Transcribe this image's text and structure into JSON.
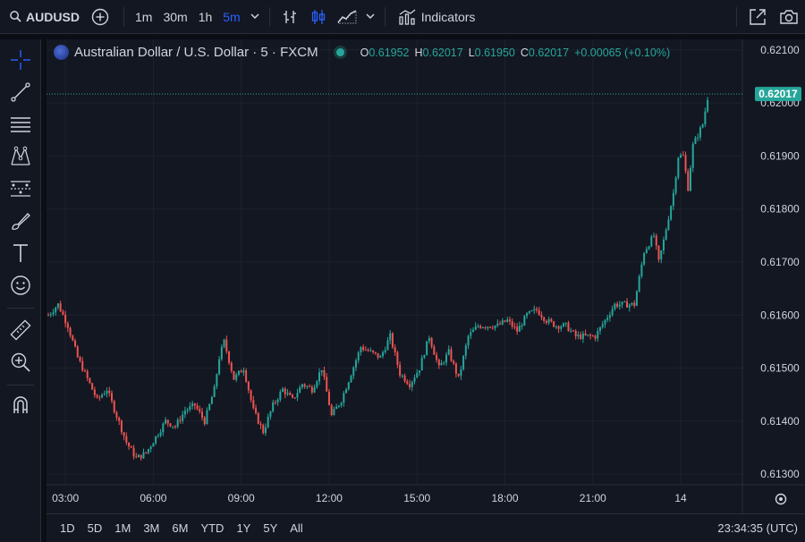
{
  "toolbar": {
    "symbol": "AUDUSD",
    "intervals": [
      "1m",
      "30m",
      "1h",
      "5m"
    ],
    "active_interval": "5m",
    "indicators_label": "Indicators"
  },
  "legend": {
    "title": "Australian Dollar / U.S. Dollar · 5 · FXCM",
    "o_label": "O",
    "o": "0.61952",
    "h_label": "H",
    "h": "0.62017",
    "l_label": "L",
    "l": "0.61950",
    "c_label": "C",
    "c": "0.62017",
    "change": "+0.00065 (+0.10%)"
  },
  "price_axis": {
    "ticks": [
      "0.62100",
      "0.62000",
      "0.61900",
      "0.61800",
      "0.61700",
      "0.61600",
      "0.61500",
      "0.61400",
      "0.61300"
    ],
    "current_price": "0.62017"
  },
  "time_axis": {
    "ticks": [
      "03:00",
      "06:00",
      "09:00",
      "12:00",
      "15:00",
      "18:00",
      "21:00",
      "14"
    ]
  },
  "ranges": [
    "1D",
    "5D",
    "1M",
    "3M",
    "6M",
    "YTD",
    "1Y",
    "5Y",
    "All"
  ],
  "clock": "23:34:35 (UTC)",
  "colors": {
    "up": "#26a69a",
    "down": "#ef5350",
    "background": "#131722",
    "active": "#2962ff"
  },
  "chart_data": {
    "type": "candlestick",
    "ylim": [
      0.6128,
      0.6212
    ],
    "bar_interval": "5m",
    "close_path": [
      [
        0,
        0.616
      ],
      [
        4,
        0.6162
      ],
      [
        8,
        0.6158
      ],
      [
        12,
        0.6152
      ],
      [
        16,
        0.6148
      ],
      [
        20,
        0.6144
      ],
      [
        24,
        0.6146
      ],
      [
        28,
        0.6141
      ],
      [
        32,
        0.6136
      ],
      [
        36,
        0.6133
      ],
      [
        40,
        0.6134
      ],
      [
        44,
        0.6137
      ],
      [
        48,
        0.614
      ],
      [
        52,
        0.6139
      ],
      [
        56,
        0.6142
      ],
      [
        60,
        0.6143
      ],
      [
        64,
        0.614
      ],
      [
        68,
        0.6146
      ],
      [
        70,
        0.6152
      ],
      [
        72,
        0.6155
      ],
      [
        76,
        0.6148
      ],
      [
        80,
        0.615
      ],
      [
        84,
        0.6142
      ],
      [
        88,
        0.6138
      ],
      [
        92,
        0.6143
      ],
      [
        96,
        0.6146
      ],
      [
        100,
        0.6144
      ],
      [
        104,
        0.6147
      ],
      [
        108,
        0.6146
      ],
      [
        112,
        0.615
      ],
      [
        116,
        0.6141
      ],
      [
        120,
        0.6144
      ],
      [
        124,
        0.6149
      ],
      [
        128,
        0.6154
      ],
      [
        132,
        0.6153
      ],
      [
        136,
        0.6152
      ],
      [
        140,
        0.6156
      ],
      [
        144,
        0.6149
      ],
      [
        148,
        0.6147
      ],
      [
        152,
        0.615
      ],
      [
        156,
        0.6156
      ],
      [
        160,
        0.615
      ],
      [
        164,
        0.6153
      ],
      [
        168,
        0.6148
      ],
      [
        172,
        0.6156
      ],
      [
        176,
        0.6158
      ],
      [
        180,
        0.6158
      ],
      [
        184,
        0.6158
      ],
      [
        188,
        0.6159
      ],
      [
        192,
        0.6157
      ],
      [
        196,
        0.616
      ],
      [
        200,
        0.6161
      ],
      [
        204,
        0.6159
      ],
      [
        208,
        0.6158
      ],
      [
        212,
        0.6158
      ],
      [
        216,
        0.6156
      ],
      [
        220,
        0.6156
      ],
      [
        224,
        0.6156
      ],
      [
        228,
        0.6159
      ],
      [
        232,
        0.6162
      ],
      [
        236,
        0.6162
      ],
      [
        240,
        0.6162
      ],
      [
        244,
        0.6172
      ],
      [
        248,
        0.6175
      ],
      [
        250,
        0.617
      ],
      [
        252,
        0.6174
      ],
      [
        256,
        0.6183
      ],
      [
        258,
        0.619
      ],
      [
        260,
        0.619
      ],
      [
        262,
        0.6184
      ],
      [
        264,
        0.6192
      ],
      [
        268,
        0.6196
      ],
      [
        270,
        0.6201
      ]
    ]
  }
}
